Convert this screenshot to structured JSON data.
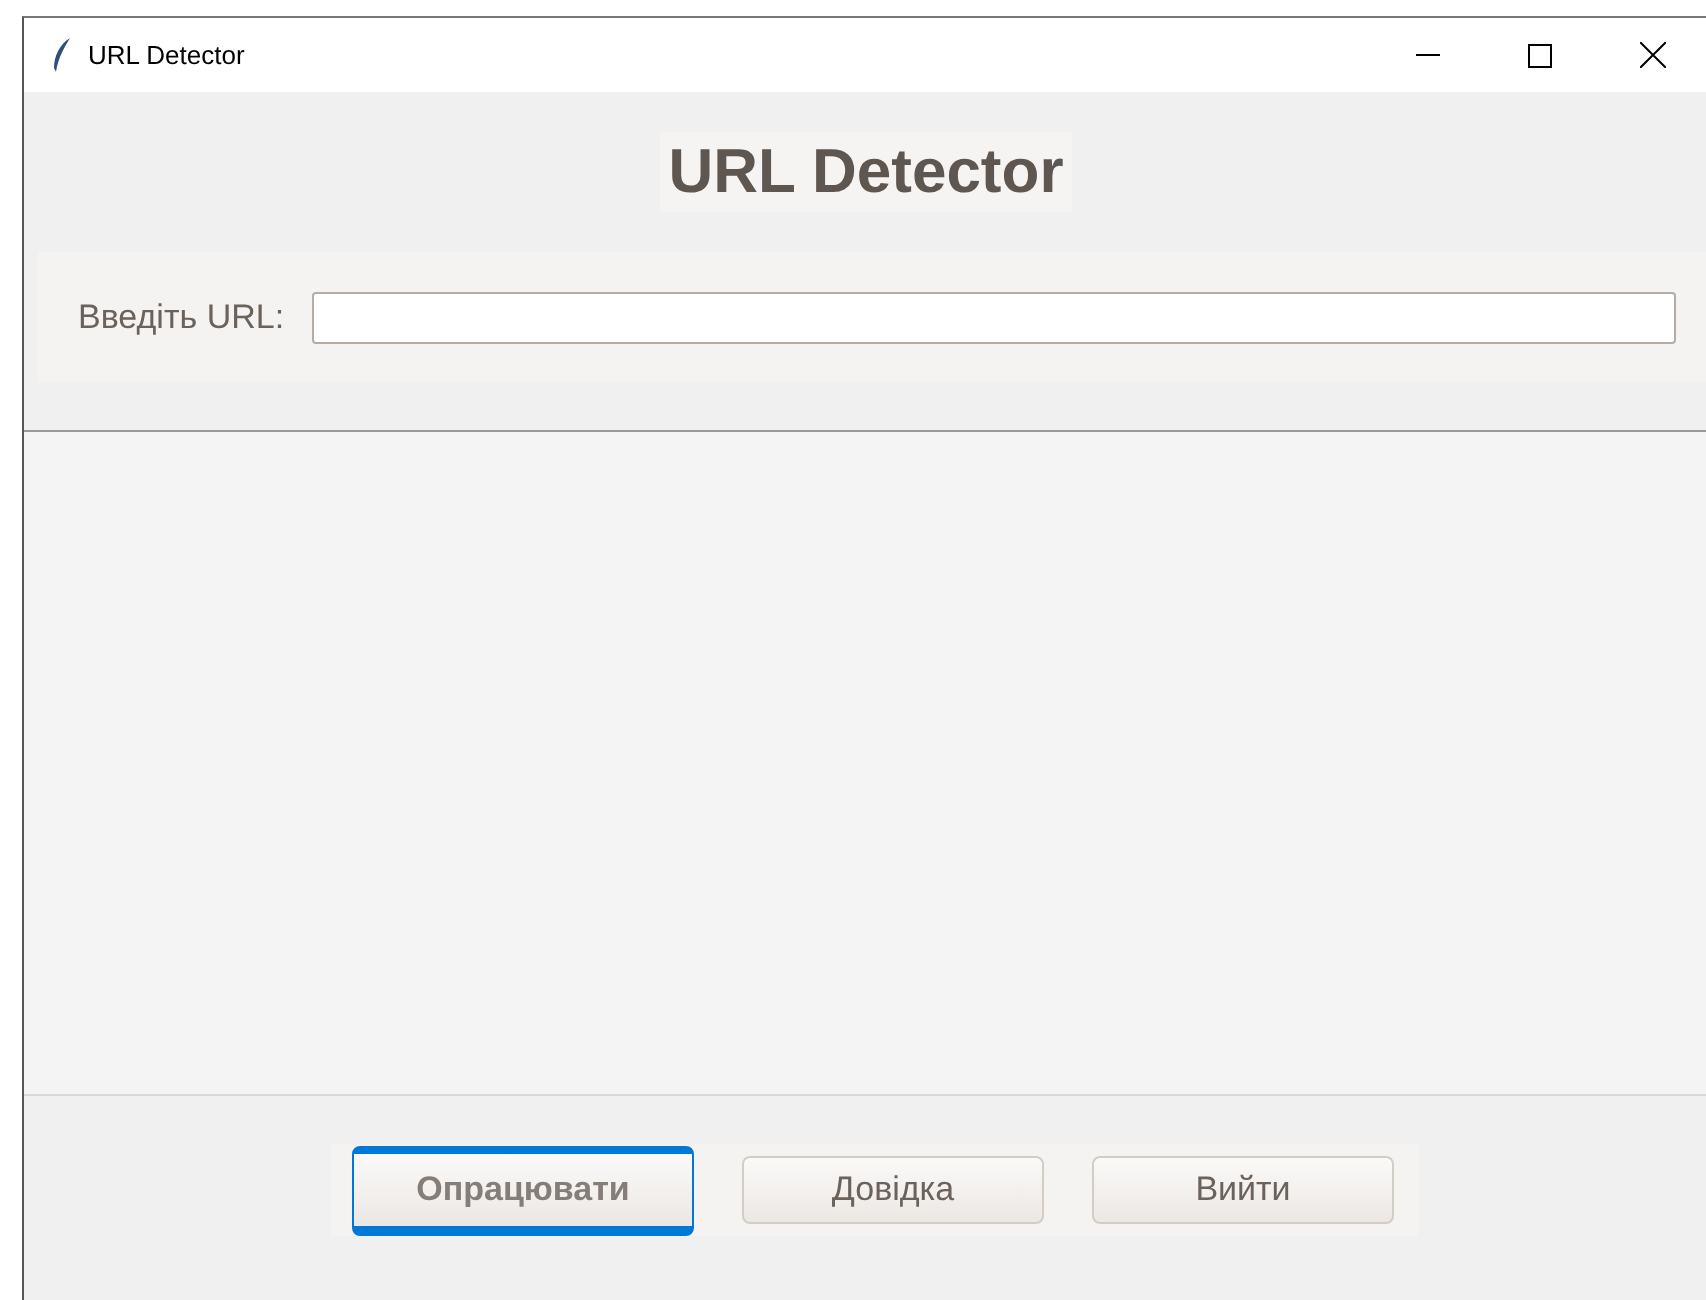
{
  "window": {
    "title": "URL Detector"
  },
  "heading": "URL Detector",
  "url_field": {
    "label": "Введіть URL:"
  },
  "buttons": [
    {
      "label": "Опрацювати",
      "focused": true
    },
    {
      "label": "Довідка",
      "focused": false
    },
    {
      "label": "Вийти",
      "focused": false
    }
  ]
}
